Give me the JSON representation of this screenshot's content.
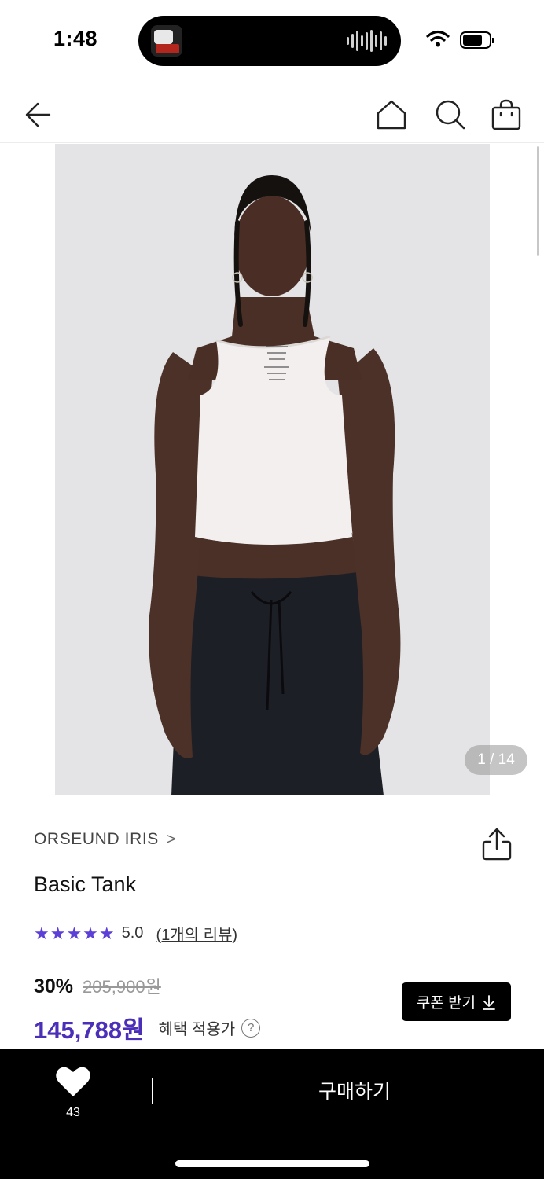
{
  "status_bar": {
    "time": "1:48"
  },
  "nav": {
    "back_icon": "arrow-left-icon",
    "home_icon": "home-icon",
    "search_icon": "search-icon",
    "cart_icon": "shopping-bag-icon"
  },
  "gallery": {
    "counter": "1 / 14"
  },
  "product": {
    "brand": "ORSEUND IRIS",
    "brand_chevron": ">",
    "title": "Basic Tank",
    "rating_stars": "★★★★★",
    "rating": "5.0",
    "reviews_link": "(1개의 리뷰)",
    "discount": "30%",
    "original_price": "205,900원",
    "sale_price": "145,788원",
    "benefit_label": "혜택 적용가",
    "help": "?"
  },
  "coupon": {
    "label": "쿠폰 받기",
    "icon": "download-arrow-icon"
  },
  "bottom_bar": {
    "like_count": "43",
    "buy_label": "구매하기"
  },
  "colors": {
    "accent": "#4b2fb8",
    "star": "#5b3fd6",
    "bar": "#000000"
  }
}
